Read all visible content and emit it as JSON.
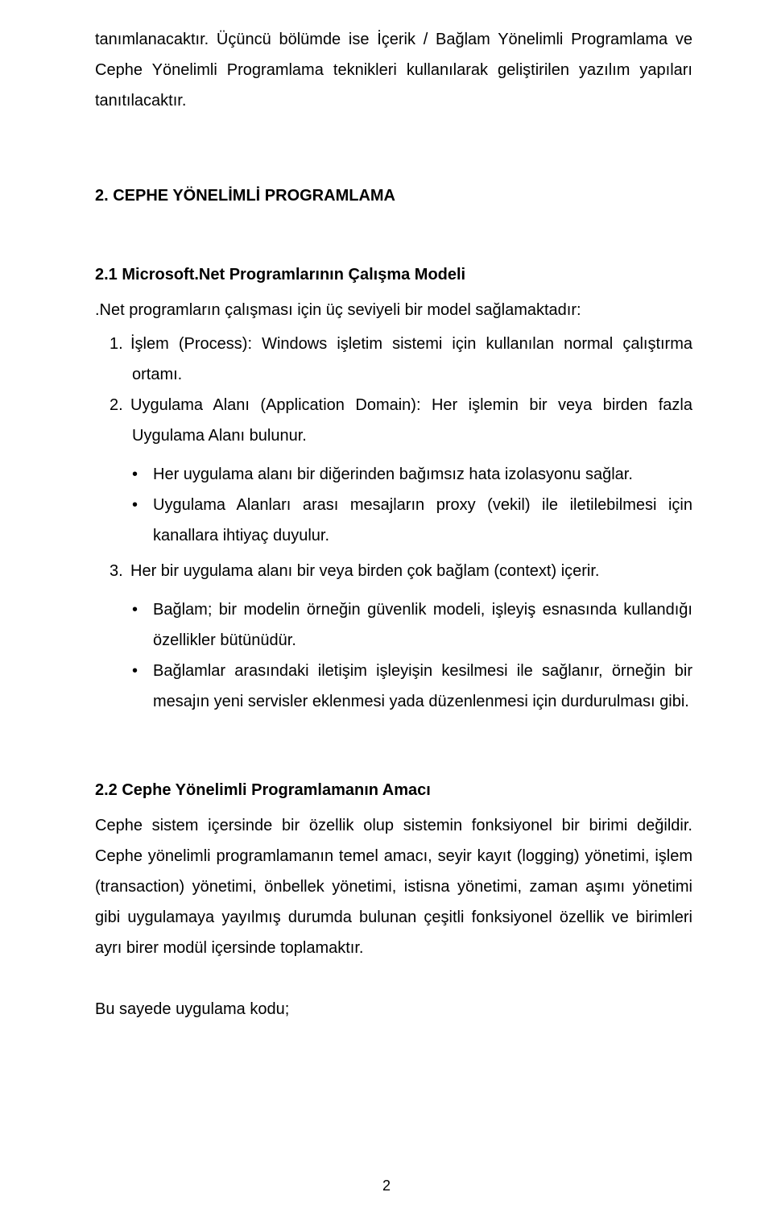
{
  "intro_paragraph": "tanımlanacaktır. Üçüncü bölümde ise İçerik / Bağlam Yönelimli Programlama ve Cephe Yönelimli Programlama teknikleri kullanılarak geliştirilen yazılım yapıları tanıtılacaktır.",
  "section2_heading": "2. CEPHE YÖNELİMLİ PROGRAMLAMA",
  "section21_heading": "2.1 Microsoft.Net Programlarının Çalışma Modeli",
  "s21_intro": ".Net programların çalışması için üç seviyeli bir model sağlamaktadır:",
  "s21_item1_num": "1.",
  "s21_item1_text": "İşlem (Process): Windows işletim sistemi için kullanılan normal çalıştırma ortamı.",
  "s21_item2_num": "2.",
  "s21_item2_text": "Uygulama Alanı (Application Domain): Her işlemin bir veya birden fazla Uygulama Alanı bulunur.",
  "s21_item2_b1": "Her uygulama alanı bir diğerinden bağımsız hata izolasyonu sağlar.",
  "s21_item2_b2": "Uygulama Alanları arası mesajların proxy (vekil) ile iletilebilmesi için kanallara ihtiyaç duyulur.",
  "s21_item3_num": "3.",
  "s21_item3_text": "Her bir uygulama alanı bir veya birden çok bağlam (context) içerir.",
  "s21_item3_b1": "Bağlam; bir modelin örneğin güvenlik modeli, işleyiş esnasında kullandığı özellikler bütünüdür.",
  "s21_item3_b2": "Bağlamlar arasındaki iletişim işleyişin kesilmesi ile sağlanır, örneğin bir mesajın yeni servisler eklenmesi yada düzenlenmesi için durdurulması gibi.",
  "section22_heading": "2.2 Cephe Yönelimli Programlamanın Amacı",
  "s22_para": "Cephe sistem içersinde bir özellik olup sistemin fonksiyonel bir birimi değildir. Cephe yönelimli programlamanın temel amacı, seyir kayıt (logging) yönetimi, işlem (transaction) yönetimi, önbellek yönetimi, istisna yönetimi, zaman aşımı yönetimi gibi uygulamaya yayılmış durumda bulunan çeşitli fonksiyonel özellik ve birimleri ayrı birer modül içersinde toplamaktır.",
  "closing_line": "Bu sayede uygulama kodu;",
  "bullet_glyph": "•",
  "page_number": "2"
}
